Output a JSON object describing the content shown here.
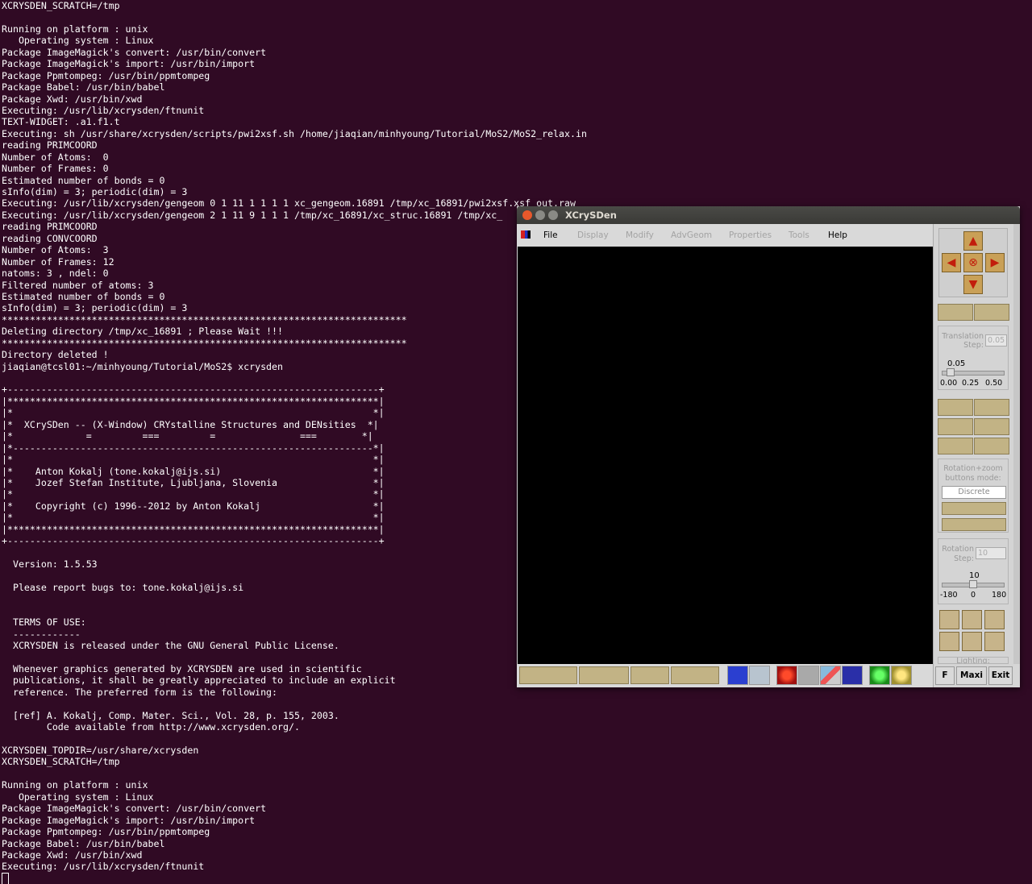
{
  "terminal": {
    "lines": [
      "XCRYSDEN_SCRATCH=/tmp",
      "",
      "Running on platform : unix",
      "   Operating system : Linux",
      "Package ImageMagick's convert: /usr/bin/convert",
      "Package ImageMagick's import: /usr/bin/import",
      "Package Ppmtompeg: /usr/bin/ppmtompeg",
      "Package Babel: /usr/bin/babel",
      "Package Xwd: /usr/bin/xwd",
      "Executing: /usr/lib/xcrysden/ftnunit",
      "TEXT-WIDGET: .a1.f1.t",
      "Executing: sh /usr/share/xcrysden/scripts/pwi2xsf.sh /home/jiaqian/minhyoung/Tutorial/MoS2/MoS2_relax.in",
      "reading PRIMCOORD",
      "Number of Atoms:  0",
      "Number of Frames: 0",
      "Estimated number of bonds = 0",
      "sInfo(dim) = 3; periodic(dim) = 3",
      "Executing: /usr/lib/xcrysden/gengeom 0 1 11 1 1 1 1 xc_gengeom.16891 /tmp/xc_16891/pwi2xsf.xsf out.raw",
      "Executing: /usr/lib/xcrysden/gengeom 2 1 11 9 1 1 1 /tmp/xc_16891/xc_struc.16891 /tmp/xc_",
      "reading PRIMCOORD",
      "reading CONVCOORD",
      "Number of Atoms:  3",
      "Number of Frames: 12",
      "natoms: 3 , ndel: 0",
      "Filtered number of atoms: 3",
      "Estimated number of bonds = 0",
      "sInfo(dim) = 3; periodic(dim) = 3",
      "************************************************************************",
      "Deleting directory /tmp/xc_16891 ; Please Wait !!!",
      "************************************************************************",
      "Directory deleted !",
      "jiaqian@tcsl01:~/minhyoung/Tutorial/MoS2$ xcrysden",
      "",
      "+------------------------------------------------------------------+",
      "|******************************************************************|",
      "|*                                                                *|",
      "|*  XCrySDen -- (X-Window) CRYstalline Structures and DENsities  *|",
      "|*             =         ===         =               ===        *|",
      "|*----------------------------------------------------------------*|",
      "|*                                                                *|",
      "|*    Anton Kokalj (tone.kokalj@ijs.si)                           *|",
      "|*    Jozef Stefan Institute, Ljubljana, Slovenia                 *|",
      "|*                                                                *|",
      "|*    Copyright (c) 1996--2012 by Anton Kokalj                    *|",
      "|*                                                                *|",
      "|******************************************************************|",
      "+------------------------------------------------------------------+",
      "",
      "  Version: 1.5.53",
      "",
      "  Please report bugs to: tone.kokalj@ijs.si",
      "",
      "",
      "  TERMS OF USE:",
      "  ------------",
      "  XCRYSDEN is released under the GNU General Public License.",
      "",
      "  Whenever graphics generated by XCRYSDEN are used in scientific",
      "  publications, it shall be greatly appreciated to include an explicit",
      "  reference. The preferred form is the following:",
      "",
      "  [ref] A. Kokalj, Comp. Mater. Sci., Vol. 28, p. 155, 2003.",
      "        Code available from http://www.xcrysden.org/.",
      "",
      "XCRYSDEN_TOPDIR=/usr/share/xcrysden",
      "XCRYSDEN_SCRATCH=/tmp",
      "",
      "Running on platform : unix",
      "   Operating system : Linux",
      "Package ImageMagick's convert: /usr/bin/convert",
      "Package ImageMagick's import: /usr/bin/import",
      "Package Ppmtompeg: /usr/bin/ppmtompeg",
      "Package Babel: /usr/bin/babel",
      "Package Xwd: /usr/bin/xwd",
      "Executing: /usr/lib/xcrysden/ftnunit"
    ]
  },
  "window": {
    "title": "XCrySDen",
    "menus": [
      {
        "label": "File",
        "enabled": true
      },
      {
        "label": "Display",
        "enabled": false
      },
      {
        "label": "Modify",
        "enabled": false
      },
      {
        "label": "AdvGeom",
        "enabled": false
      },
      {
        "label": "Properties",
        "enabled": false
      },
      {
        "label": "Tools",
        "enabled": false
      },
      {
        "label": "Help",
        "enabled": true
      }
    ]
  },
  "panel": {
    "translation_label_1": "Translation",
    "translation_label_2": "Step:",
    "translation_field": "0.05",
    "translation_value": "0.05",
    "translation_ticks": [
      "0.00",
      "0.25",
      "0.50"
    ],
    "mode_label_1": "Rotation+zoom",
    "mode_label_2": "buttons mode:",
    "mode_selected": "Discrete",
    "rotation_label_1": "Rotation",
    "rotation_label_2": "Step:",
    "rotation_field": "10",
    "rotation_value": "10",
    "rotation_ticks": [
      "-180",
      "0",
      "180"
    ],
    "lighting_label": "Lighting:"
  },
  "bottom_right": {
    "f_label": "F",
    "maxi_label": "Maxi",
    "exit_label": "Exit"
  },
  "colors": {
    "terminal_bg": "#300a24",
    "button_tan": "#c2b385",
    "close_button": "#e9582b"
  }
}
